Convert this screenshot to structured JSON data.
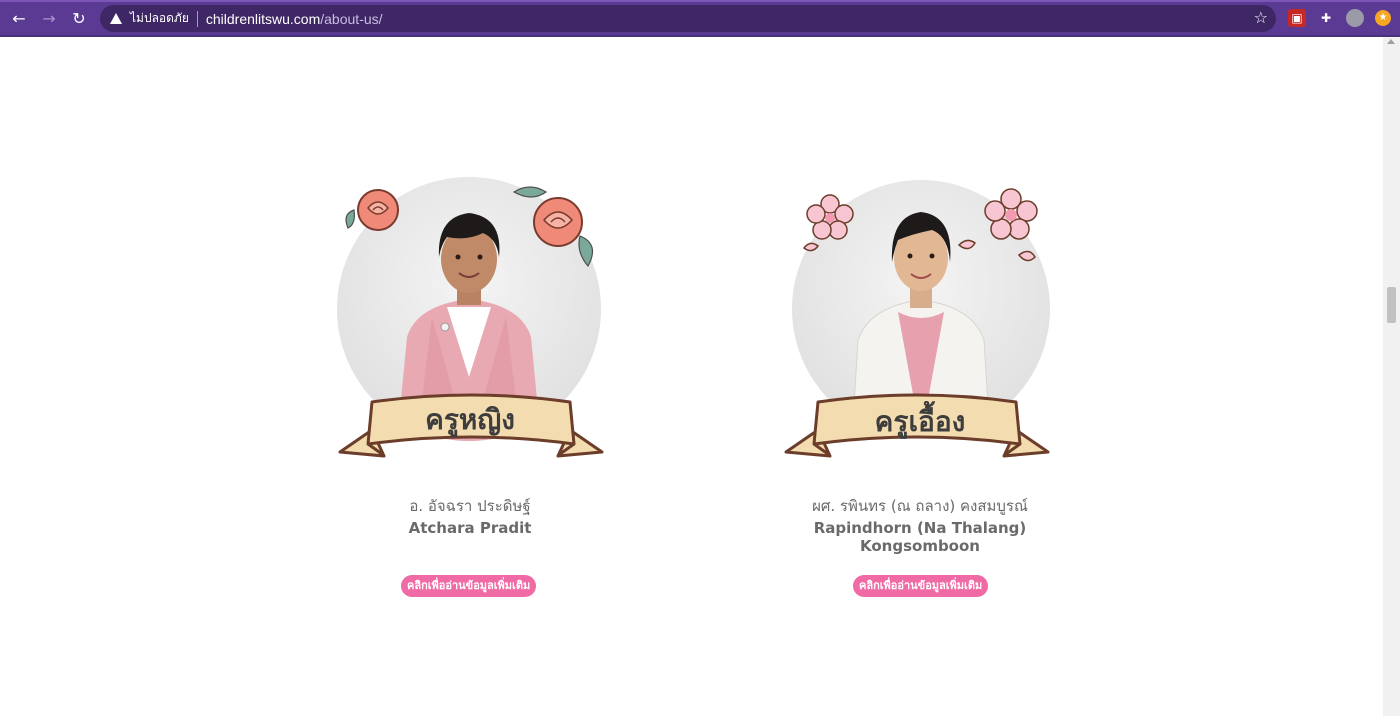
{
  "browser": {
    "security_label": "ไม่ปลอดภัย",
    "url_host": "childrenlitswu.com",
    "url_path": "/about-us/",
    "icons": [
      "back-arrow-icon",
      "forward-arrow-icon",
      "reload-icon",
      "warning-icon",
      "star-icon",
      "extension-icon",
      "puzzle-icon",
      "avatar",
      "notification-icon"
    ]
  },
  "profiles": [
    {
      "banner": "ครูหญิง",
      "name_th": "อ. อัจฉรา ประดิษฐ์",
      "name_en": "Atchara Pradit",
      "button": "คลิกเพื่ออ่านข้อมูลเพิ่มเติม"
    },
    {
      "banner": "ครูเอื้อง",
      "name_th": "ผศ. รพินทร (ณ ถลาง) คงสมบูรณ์",
      "name_en": "Rapindhorn (Na Thalang) Kongsomboon",
      "button": "คลิกเพื่ออ่านข้อมูลเพิ่มเติม"
    }
  ],
  "colors": {
    "browser_bar": "#5b3a93",
    "button_pink": "#f06aa5",
    "ribbon": "#f3ddb0",
    "ribbon_outline": "#6b3d2a",
    "rose": "#f08a78",
    "blossom": "#f8c6d2"
  }
}
